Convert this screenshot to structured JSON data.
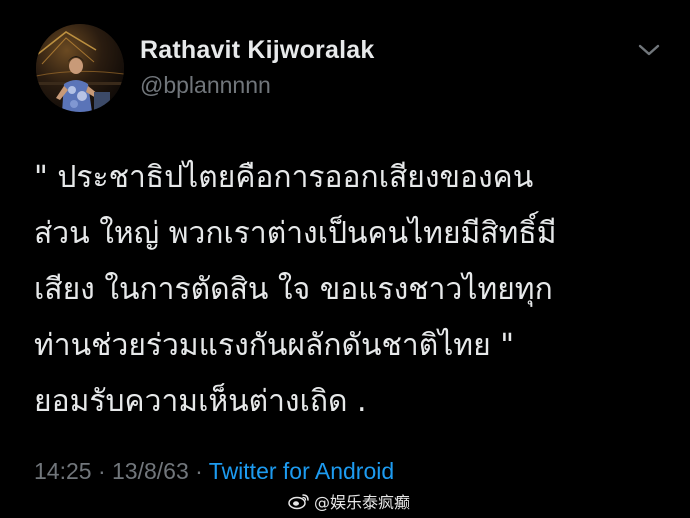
{
  "tweet": {
    "display_name": "Rathavit Kijworalak",
    "handle": "@bplannnnn",
    "text_lines": [
      "\" ประชาธิปไตยคือการออกเสียงของคน",
      "ส่วน ใหญ่ พวกเราต่างเป็นคนไทยมีสิทธิ์มี",
      "เสียง ในการตัดสิน ใจ ขอแรงชาวไทยทุก",
      "ท่านช่วยร่วมแรงกันผลักดันชาติไทย \"",
      "ยอมรับความเห็นต่างเถิด ."
    ],
    "time": "14:25",
    "date": "13/8/63",
    "separator": "·",
    "source": "Twitter for Android",
    "menu_icon": "chevron-down-icon",
    "avatar_icon": "profile-photo"
  },
  "watermark": {
    "icon": "weibo-logo-icon",
    "text": "@娱乐泰疯癫"
  },
  "colors": {
    "background": "#000000",
    "primary_text": "#e7e9ea",
    "secondary_text": "#71767b",
    "link": "#1d9bf0"
  }
}
